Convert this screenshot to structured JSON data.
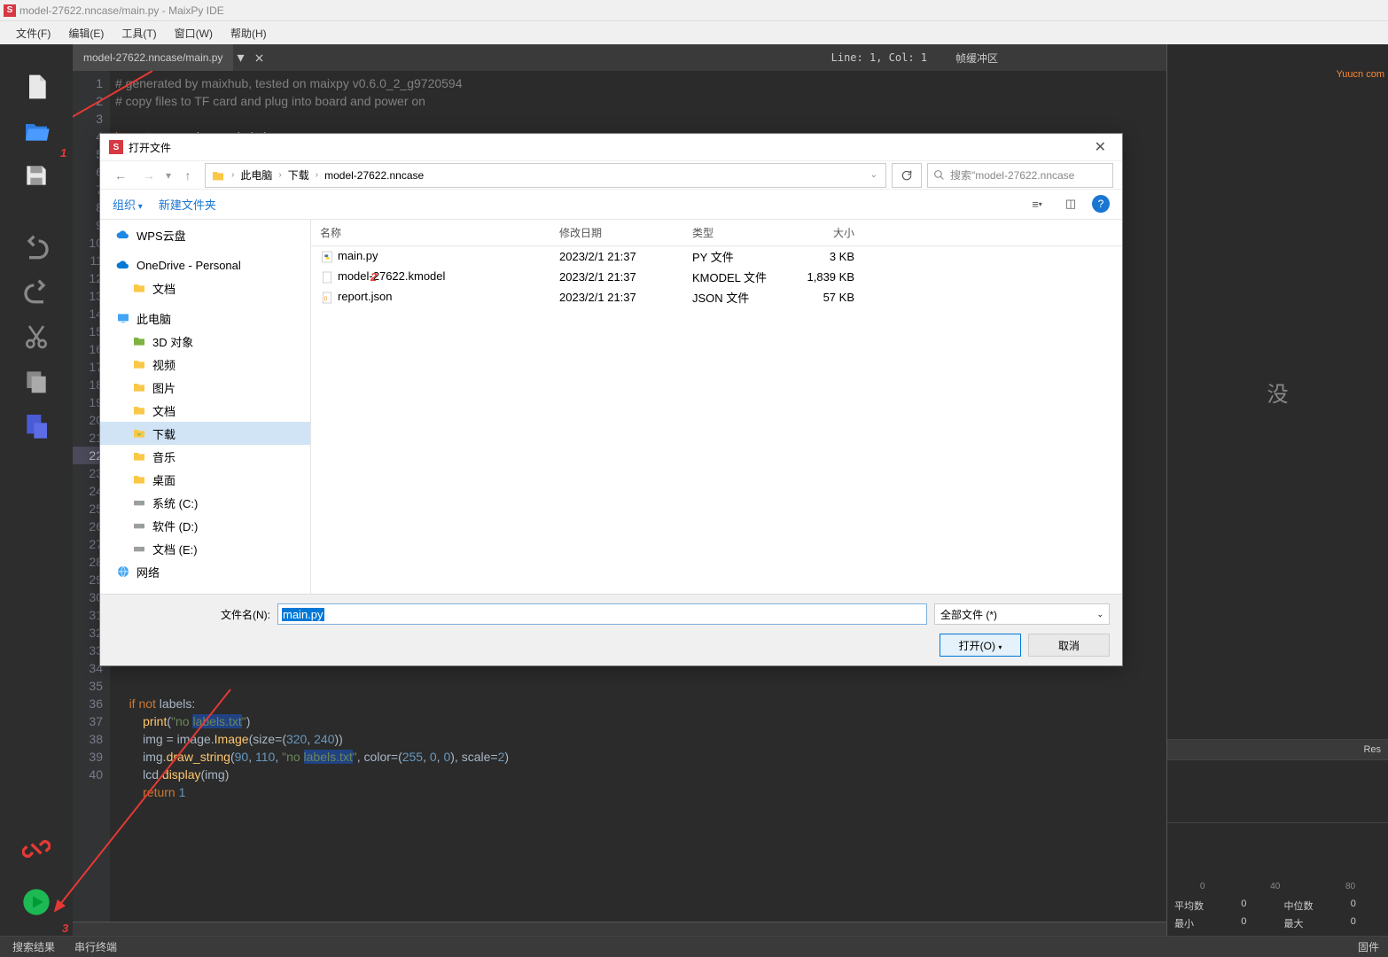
{
  "window": {
    "title": "model-27622.nncase/main.py - MaixPy IDE"
  },
  "menubar": [
    "文件(F)",
    "编辑(E)",
    "工具(T)",
    "窗口(W)",
    "帮助(H)"
  ],
  "tab": {
    "label": "model-27622.nncase/main.py",
    "close": "⨯"
  },
  "status": {
    "line_col": "Line: 1, Col: 1",
    "framebuffer": "帧缓冲区"
  },
  "gutter_lines": 40,
  "code_lines": [
    {
      "t": "cm",
      "s": "# generated by maixhub, tested on maixpy v0.6.0_2_g9720594"
    },
    {
      "t": "cm",
      "s": "# copy files to TF card and plug into board and power on"
    },
    {
      "t": "",
      "s": ""
    },
    {
      "t": "raw",
      "s": "<span class='kw'>import</span> sensor, image, lcd, time"
    },
    {
      "t": "",
      "s": ""
    },
    {
      "t": "",
      "s": ""
    },
    {
      "t": "",
      "s": ""
    },
    {
      "t": "",
      "s": ""
    },
    {
      "t": "",
      "s": ""
    },
    {
      "t": "",
      "s": ""
    },
    {
      "t": "",
      "s": ""
    },
    {
      "t": "",
      "s": ""
    },
    {
      "t": "",
      "s": ""
    },
    {
      "t": "",
      "s": ""
    },
    {
      "t": "",
      "s": ""
    },
    {
      "t": "",
      "s": ""
    },
    {
      "t": "",
      "s": ""
    },
    {
      "t": "",
      "s": ""
    },
    {
      "t": "",
      "s": ""
    },
    {
      "t": "",
      "s": ""
    },
    {
      "t": "",
      "s": ""
    },
    {
      "t": "",
      "s": ""
    },
    {
      "t": "",
      "s": ""
    },
    {
      "t": "",
      "s": ""
    },
    {
      "t": "",
      "s": ""
    },
    {
      "t": "",
      "s": ""
    },
    {
      "t": "",
      "s": ""
    },
    {
      "t": "",
      "s": ""
    },
    {
      "t": "",
      "s": ""
    },
    {
      "t": "",
      "s": ""
    },
    {
      "t": "",
      "s": ""
    },
    {
      "t": "",
      "s": ""
    },
    {
      "t": "",
      "s": ""
    },
    {
      "t": "",
      "s": ""
    },
    {
      "t": "",
      "s": ""
    },
    {
      "t": "raw",
      "s": "    <span class='kw'>if</span> <span class='kw'>not</span> labels:"
    },
    {
      "t": "raw",
      "s": "        <span class='fn'>print</span>(<span class='str'>\"no</span> <span class='strbg'>labels.txt</span><span class='str'>\"</span>)"
    },
    {
      "t": "raw",
      "s": "        img = image.<span class='fn'>Image</span>(size=(<span class='num'>320</span>, <span class='num'>240</span>))"
    },
    {
      "t": "raw",
      "s": "        img.<span class='fn'>draw_string</span>(<span class='num'>90</span>, <span class='num'>110</span>, <span class='str'>\"no</span> <span class='strbg'>labels.txt</span><span class='str'>\"</span>, color=(<span class='num'>255</span>, <span class='num'>0</span>, <span class='num'>0</span>), scale=<span class='num'>2</span>)"
    },
    {
      "t": "raw",
      "s": "        lcd.<span class='fn'>display</span>(img)"
    },
    {
      "t": "raw",
      "s": "        <span class='kw'>return</span> <span class='num'>1</span>"
    }
  ],
  "right_panel": {
    "no_image": "没",
    "res_label": "Res",
    "axis_ticks": [
      "0",
      "40",
      "80"
    ],
    "stats": {
      "mean_label": "平均数",
      "mean_val": "0",
      "median_label": "中位数",
      "median_val": "0",
      "min_label": "最小",
      "min_val": "0",
      "max_label": "最大",
      "max_val": "0"
    },
    "watermark": "Yuucn com",
    "fixed_label": "固件"
  },
  "bottom_tabs": [
    "搜索结果",
    "串行终端"
  ],
  "file_dialog": {
    "title": "打开文件",
    "path_parts": [
      "此电脑",
      "下载",
      "model-27622.nncase"
    ],
    "search_placeholder": "搜索\"model-27622.nncase",
    "toolbar": {
      "organize": "组织",
      "newfolder": "新建文件夹"
    },
    "tree": [
      {
        "icon": "cloud-blue",
        "label": "WPS云盘",
        "ind": 0
      },
      {
        "icon": "cloud",
        "label": "OneDrive - Personal",
        "ind": 0
      },
      {
        "icon": "folder",
        "label": "文档",
        "ind": 1
      },
      {
        "icon": "pc",
        "label": "此电脑",
        "ind": 0
      },
      {
        "icon": "folder-3d",
        "label": "3D 对象",
        "ind": 1
      },
      {
        "icon": "folder-y",
        "label": "视频",
        "ind": 1
      },
      {
        "icon": "folder-y",
        "label": "图片",
        "ind": 1
      },
      {
        "icon": "folder-y",
        "label": "文档",
        "ind": 1
      },
      {
        "icon": "folder-dl",
        "label": "下载",
        "ind": 1,
        "sel": true
      },
      {
        "icon": "folder-y",
        "label": "音乐",
        "ind": 1
      },
      {
        "icon": "folder-y",
        "label": "桌面",
        "ind": 1
      },
      {
        "icon": "drive",
        "label": "系统 (C:)",
        "ind": 1
      },
      {
        "icon": "drive",
        "label": "软件 (D:)",
        "ind": 1
      },
      {
        "icon": "drive",
        "label": "文档 (E:)",
        "ind": 1
      },
      {
        "icon": "network",
        "label": "网络",
        "ind": 0
      }
    ],
    "list_headers": {
      "name": "名称",
      "date": "修改日期",
      "type": "类型",
      "size": "大小"
    },
    "files": [
      {
        "icon": "py",
        "name": "main.py",
        "date": "2023/2/1 21:37",
        "type": "PY 文件",
        "size": "3 KB"
      },
      {
        "icon": "file",
        "name": "model-27622.kmodel",
        "date": "2023/2/1 21:37",
        "type": "KMODEL 文件",
        "size": "1,839 KB"
      },
      {
        "icon": "json",
        "name": "report.json",
        "date": "2023/2/1 21:37",
        "type": "JSON 文件",
        "size": "57 KB"
      }
    ],
    "filename_label": "文件名(N):",
    "filename_value": "main.py",
    "filter": "全部文件 (*)",
    "open_btn": "打开(O)",
    "cancel_btn": "取消"
  },
  "annotations": {
    "n1": "1",
    "n2": "2",
    "n3": "3"
  }
}
